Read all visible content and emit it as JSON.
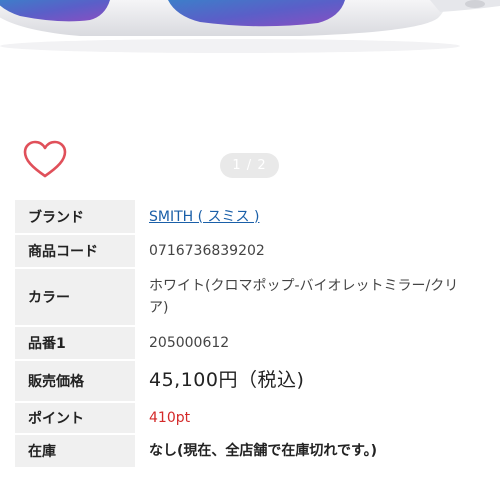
{
  "product": {
    "color_accent": "#e0505a",
    "favorite_icon": "heart-outline-icon",
    "pager": "1 / 2"
  },
  "specs": {
    "brand_label": "ブランド",
    "brand_value": "SMITH ( スミス )",
    "code_label": "商品コード",
    "code_value": "0716736839202",
    "color_label": "カラー",
    "color_value": "ホワイト(クロマポップ-バイオレットミラー/クリア)",
    "number_label": "品番1",
    "number_value": "205000612",
    "price_label": "販売価格",
    "price_value": "45,100円（税込)",
    "point_label": "ポイント",
    "point_value": "410pt",
    "stock_label": "在庫",
    "stock_value": "なし(現在、全店舗で在庫切れです。)"
  }
}
